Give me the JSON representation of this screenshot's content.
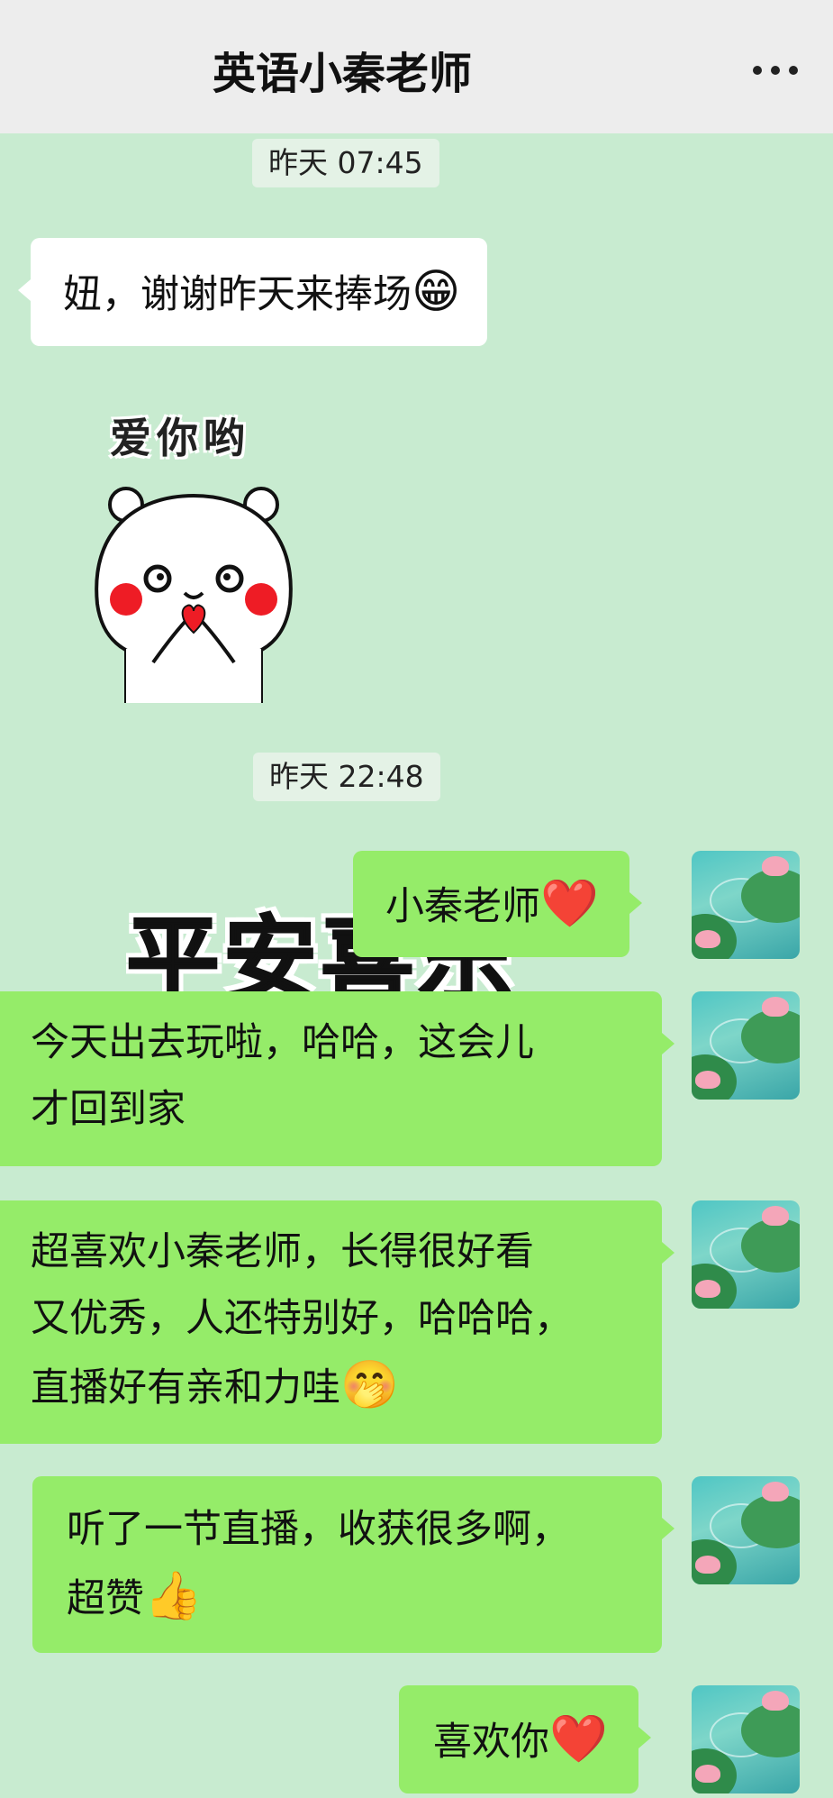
{
  "header": {
    "title": "英语小秦老师",
    "more_icon": "more-dots-icon"
  },
  "messages": {
    "time1": "昨天 07:45",
    "msg1": "妞，谢谢昨天来捧场",
    "msg1_emoji": "😁",
    "sticker_caption": "爱你哟",
    "time2": "昨天 22:48",
    "msg2": "小秦老师",
    "msg2_emoji": "❤️",
    "sticker2_partial": "平安喜乐",
    "msg3_line1": "今天出去玩啦，哈哈，这会儿",
    "msg3_line2": "才回到家",
    "msg4_line1": "超喜欢小秦老师，长得很好看",
    "msg4_line2": "又优秀，人还特别好，哈哈哈，",
    "msg4_line3": "直播好有亲和力哇",
    "msg4_emoji": "🤭",
    "msg5_line1": "听了一节直播，收获很多啊，",
    "msg5_line2": "超赞",
    "msg5_emoji": "👍",
    "msg6": "喜欢你",
    "msg6_emoji": "❤️"
  },
  "colors": {
    "background": "#c8ebd0",
    "header": "#ededed",
    "outgoing_bubble": "#95ec69",
    "incoming_bubble": "#ffffff"
  }
}
